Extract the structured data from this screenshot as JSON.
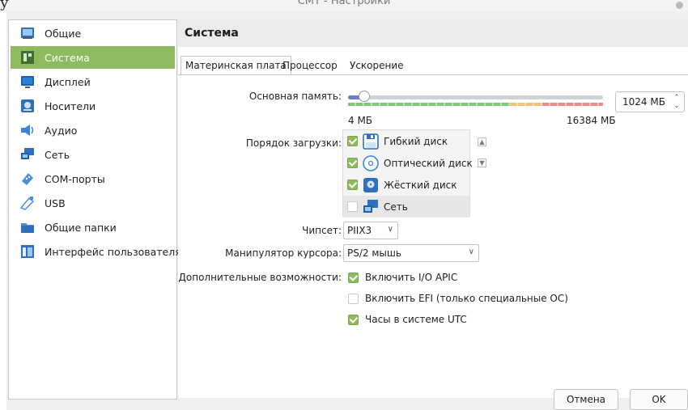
{
  "window": {
    "title": "СМТ - Настройки",
    "stray_text": "у"
  },
  "sidebar": {
    "items": [
      {
        "label": "Общие"
      },
      {
        "label": "Система"
      },
      {
        "label": "Дисплей"
      },
      {
        "label": "Носители"
      },
      {
        "label": "Аудио"
      },
      {
        "label": "Сеть"
      },
      {
        "label": "COM-порты"
      },
      {
        "label": "USB"
      },
      {
        "label": "Общие папки"
      },
      {
        "label": "Интерфейс пользователя"
      }
    ],
    "active_index": 1
  },
  "page": {
    "title": "Система",
    "tabs": [
      "Материнская плата",
      "Процессор",
      "Ускорение"
    ],
    "active_tab": 0
  },
  "motherboard": {
    "memory_label": "Основная память:",
    "memory_value": "1024 МБ",
    "memory_min": "4 МБ",
    "memory_max": "16384 МБ",
    "memory_fraction": 0.062,
    "boot_order_label": "Порядок загрузки:",
    "boot_devices": [
      {
        "label": "Гибкий диск",
        "checked": true,
        "icon": "floppy-icon"
      },
      {
        "label": "Оптический диск",
        "checked": true,
        "icon": "optical-disc-icon"
      },
      {
        "label": "Жёсткий диск",
        "checked": true,
        "icon": "hard-disk-icon"
      },
      {
        "label": "Сеть",
        "checked": false,
        "icon": "network-icon"
      }
    ],
    "chipset_label": "Чипсет:",
    "chipset_value": "PIIX3",
    "pointing_label": "Манипулятор курсора:",
    "pointing_value": "PS/2 мышь",
    "extended_label": "Дополнительные возможности:",
    "features": [
      {
        "label": "Включить I/O APIC",
        "checked": true
      },
      {
        "label": "Включить EFI (только специальные ОС)",
        "checked": false
      },
      {
        "label": "Часы в системе UTC",
        "checked": true
      }
    ]
  },
  "footer": {
    "cancel_label": "Отмена",
    "ok_label": "OK"
  },
  "colors": {
    "accent": "#8fbb5f",
    "slider_fill": "#6f7ccc"
  }
}
